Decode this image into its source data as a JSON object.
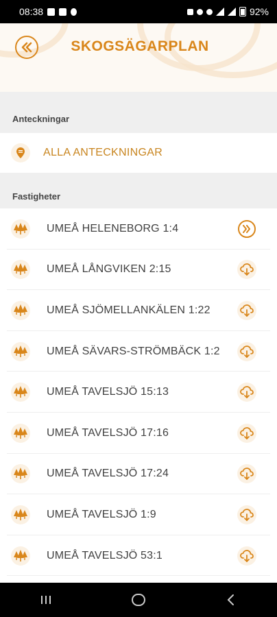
{
  "status_bar": {
    "time": "08:38",
    "battery": "92%"
  },
  "header": {
    "title": "SKOGSÄGARPLAN",
    "back_icon": "double-chevron-left-icon"
  },
  "notes_section": {
    "title": "Anteckningar",
    "all_notes_label": "ALLA ANTECKNINGAR"
  },
  "properties_section": {
    "title": "Fastigheter",
    "items": [
      {
        "label": "UMEÅ HELENEBORG 1:4",
        "action": "open"
      },
      {
        "label": "UMEÅ LÅNGVIKEN 2:15",
        "action": "download"
      },
      {
        "label": "UMEÅ SJÖMELLANKÄLEN 1:22",
        "action": "download"
      },
      {
        "label": "UMEÅ SÄVARS-STRÖMBÄCK 1:2",
        "action": "download"
      },
      {
        "label": "UMEÅ TAVELSJÖ 15:13",
        "action": "download"
      },
      {
        "label": "UMEÅ TAVELSJÖ 17:16",
        "action": "download"
      },
      {
        "label": "UMEÅ TAVELSJÖ 17:24",
        "action": "download"
      },
      {
        "label": "UMEÅ TAVELSJÖ 1:9",
        "action": "download"
      },
      {
        "label": "UMEÅ TAVELSJÖ 53:1",
        "action": "download"
      }
    ]
  },
  "colors": {
    "accent": "#d9861a",
    "section_bg": "#efefef"
  }
}
